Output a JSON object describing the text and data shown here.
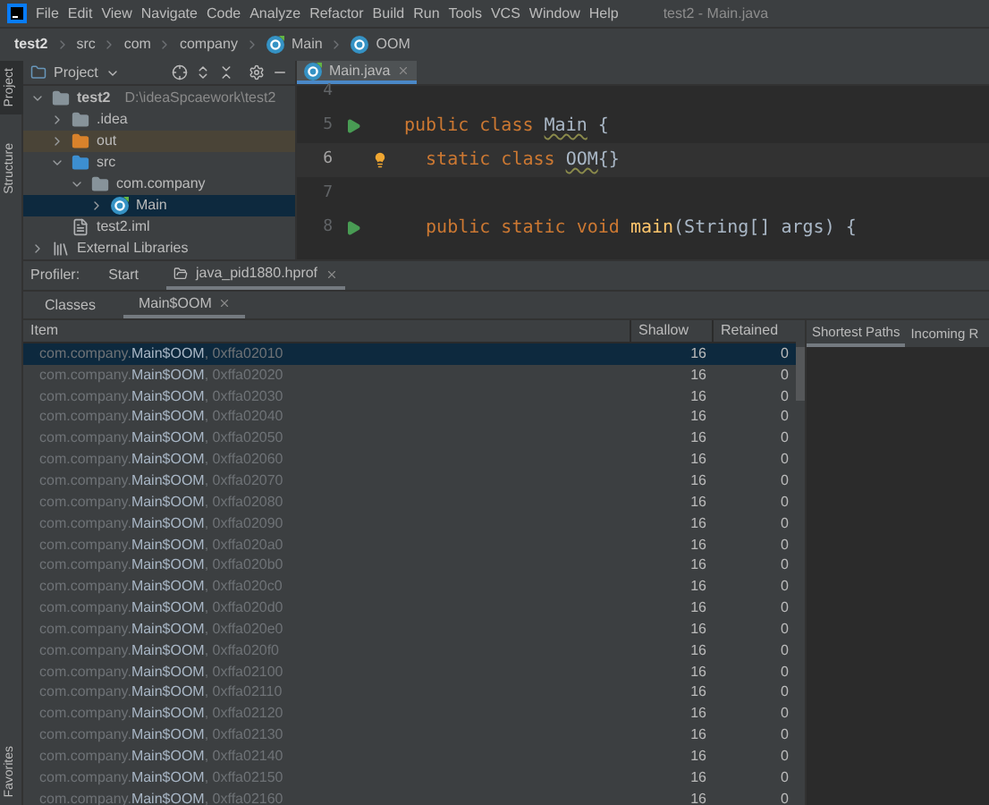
{
  "window": {
    "title": "test2 - Main.java"
  },
  "menu": [
    "File",
    "Edit",
    "View",
    "Navigate",
    "Code",
    "Analyze",
    "Refactor",
    "Build",
    "Run",
    "Tools",
    "VCS",
    "Window",
    "Help"
  ],
  "breadcrumb": [
    {
      "label": "test2",
      "kind": "root"
    },
    {
      "label": "src",
      "kind": "folder"
    },
    {
      "label": "com",
      "kind": "folder"
    },
    {
      "label": "company",
      "kind": "folder"
    },
    {
      "label": "Main",
      "kind": "class"
    },
    {
      "label": "OOM",
      "kind": "inner"
    }
  ],
  "side_tools": [
    {
      "label": "Project",
      "selected": true
    },
    {
      "label": "Structure",
      "selected": false
    }
  ],
  "bottom_side_tool": "Favorites",
  "project": {
    "title": "Project",
    "tree": [
      {
        "label": "test2",
        "path": "D:\\ideaSpcaework\\test2",
        "kind": "module",
        "expanded": true,
        "selected": false,
        "children": [
          {
            "label": ".idea",
            "kind": "folder",
            "expanded": false,
            "selected": false
          },
          {
            "label": "out",
            "kind": "excluded",
            "expanded": false,
            "selected": false
          },
          {
            "label": "src",
            "kind": "source",
            "expanded": true,
            "selected": false,
            "children": [
              {
                "label": "com.company",
                "kind": "package",
                "expanded": true,
                "selected": false,
                "children": [
                  {
                    "label": "Main",
                    "kind": "class",
                    "expanded": false,
                    "selected": true
                  }
                ]
              }
            ]
          },
          {
            "label": "test2.iml",
            "kind": "file",
            "selected": false
          }
        ]
      },
      {
        "label": "External Libraries",
        "kind": "library",
        "expanded": false,
        "selected": false
      }
    ]
  },
  "editor_tabs": [
    {
      "label": "Main.java",
      "selected": true
    }
  ],
  "code": [
    {
      "number": "4",
      "run": false,
      "current": false
    },
    {
      "number": "5",
      "run": true,
      "current": false,
      "tokens": [
        {
          "text": "public class ",
          "kind": "keyword"
        },
        {
          "text": "Main",
          "kind": "warn"
        },
        {
          "text": " {",
          "kind": "plain"
        }
      ]
    },
    {
      "number": "6",
      "run": false,
      "bulb": true,
      "current": true,
      "tokens": [
        {
          "text": "  static class ",
          "kind": "keyword"
        },
        {
          "text": "OOM",
          "kind": "warn"
        },
        {
          "text": "{}",
          "kind": "plain"
        }
      ]
    },
    {
      "number": "7",
      "run": false,
      "current": false
    },
    {
      "number": "8",
      "run": true,
      "current": false,
      "tokens": [
        {
          "text": "  public static void ",
          "kind": "keyword"
        },
        {
          "text": "main",
          "kind": "method"
        },
        {
          "text": "(String[] args) {",
          "kind": "plain"
        }
      ]
    }
  ],
  "profiler": {
    "label": "Profiler:",
    "tabs": [
      {
        "label": "Start",
        "selected": false,
        "closable": false
      },
      {
        "label": "java_pid1880.hprof",
        "selected": true,
        "closable": true
      }
    ],
    "sub_tabs": [
      {
        "label": "Classes",
        "selected": false,
        "closable": false
      },
      {
        "label": "Main$OOM",
        "selected": true,
        "closable": true
      }
    ],
    "columns": [
      "Item",
      "Shallow",
      "Retained"
    ],
    "rows": [
      {
        "package": "com.company.",
        "class": "Main$OOM",
        "address": ", 0xffa02010",
        "shallow": "16",
        "retained": "0",
        "selected": true
      },
      {
        "package": "com.company.",
        "class": "Main$OOM",
        "address": ", 0xffa02020",
        "shallow": "16",
        "retained": "0",
        "selected": false
      },
      {
        "package": "com.company.",
        "class": "Main$OOM",
        "address": ", 0xffa02030",
        "shallow": "16",
        "retained": "0",
        "selected": false
      },
      {
        "package": "com.company.",
        "class": "Main$OOM",
        "address": ", 0xffa02040",
        "shallow": "16",
        "retained": "0",
        "selected": false
      },
      {
        "package": "com.company.",
        "class": "Main$OOM",
        "address": ", 0xffa02050",
        "shallow": "16",
        "retained": "0",
        "selected": false
      },
      {
        "package": "com.company.",
        "class": "Main$OOM",
        "address": ", 0xffa02060",
        "shallow": "16",
        "retained": "0",
        "selected": false
      },
      {
        "package": "com.company.",
        "class": "Main$OOM",
        "address": ", 0xffa02070",
        "shallow": "16",
        "retained": "0",
        "selected": false
      },
      {
        "package": "com.company.",
        "class": "Main$OOM",
        "address": ", 0xffa02080",
        "shallow": "16",
        "retained": "0",
        "selected": false
      },
      {
        "package": "com.company.",
        "class": "Main$OOM",
        "address": ", 0xffa02090",
        "shallow": "16",
        "retained": "0",
        "selected": false
      },
      {
        "package": "com.company.",
        "class": "Main$OOM",
        "address": ", 0xffa020a0",
        "shallow": "16",
        "retained": "0",
        "selected": false
      },
      {
        "package": "com.company.",
        "class": "Main$OOM",
        "address": ", 0xffa020b0",
        "shallow": "16",
        "retained": "0",
        "selected": false
      },
      {
        "package": "com.company.",
        "class": "Main$OOM",
        "address": ", 0xffa020c0",
        "shallow": "16",
        "retained": "0",
        "selected": false
      },
      {
        "package": "com.company.",
        "class": "Main$OOM",
        "address": ", 0xffa020d0",
        "shallow": "16",
        "retained": "0",
        "selected": false
      },
      {
        "package": "com.company.",
        "class": "Main$OOM",
        "address": ", 0xffa020e0",
        "shallow": "16",
        "retained": "0",
        "selected": false
      },
      {
        "package": "com.company.",
        "class": "Main$OOM",
        "address": ", 0xffa020f0",
        "shallow": "16",
        "retained": "0",
        "selected": false
      },
      {
        "package": "com.company.",
        "class": "Main$OOM",
        "address": ", 0xffa02100",
        "shallow": "16",
        "retained": "0",
        "selected": false
      },
      {
        "package": "com.company.",
        "class": "Main$OOM",
        "address": ", 0xffa02110",
        "shallow": "16",
        "retained": "0",
        "selected": false
      },
      {
        "package": "com.company.",
        "class": "Main$OOM",
        "address": ", 0xffa02120",
        "shallow": "16",
        "retained": "0",
        "selected": false
      },
      {
        "package": "com.company.",
        "class": "Main$OOM",
        "address": ", 0xffa02130",
        "shallow": "16",
        "retained": "0",
        "selected": false
      },
      {
        "package": "com.company.",
        "class": "Main$OOM",
        "address": ", 0xffa02140",
        "shallow": "16",
        "retained": "0",
        "selected": false
      },
      {
        "package": "com.company.",
        "class": "Main$OOM",
        "address": ", 0xffa02150",
        "shallow": "16",
        "retained": "0",
        "selected": false
      },
      {
        "package": "com.company.",
        "class": "Main$OOM",
        "address": ", 0xffa02160",
        "shallow": "16",
        "retained": "0",
        "selected": false
      }
    ],
    "detail_tabs": [
      {
        "label": "Shortest Paths",
        "selected": true
      },
      {
        "label": "Incoming R",
        "selected": false
      }
    ]
  }
}
